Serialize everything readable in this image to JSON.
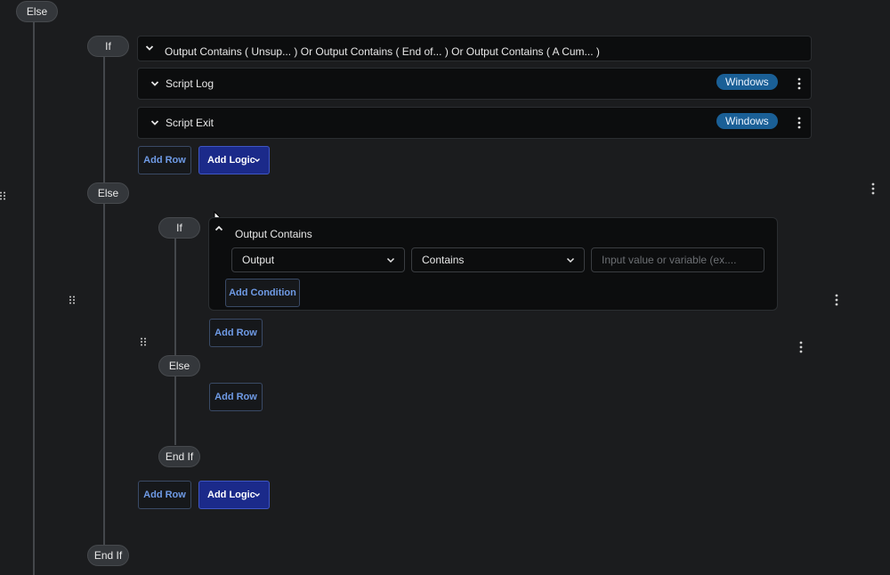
{
  "outer": {
    "else_label": "Else",
    "if_label": "If",
    "else2_label": "Else",
    "endif_label": "End If"
  },
  "condition_card": {
    "text": "Output Contains ( Unsup... ) Or Output Contains ( End of... ) Or Output Contains ( A Cum... )"
  },
  "rows": [
    {
      "title": "Script Log",
      "badge": "Windows"
    },
    {
      "title": "Script Exit",
      "badge": "Windows"
    }
  ],
  "buttons": {
    "add_row": "Add Row",
    "add_logic": "Add Logic",
    "add_condition": "Add Condition"
  },
  "inner": {
    "if_label": "If",
    "else_label": "Else",
    "endif_label": "End If",
    "condition_title": "Output Contains",
    "field_select": "Output",
    "operator_select": "Contains",
    "value_placeholder": "Input value or variable (ex...."
  }
}
